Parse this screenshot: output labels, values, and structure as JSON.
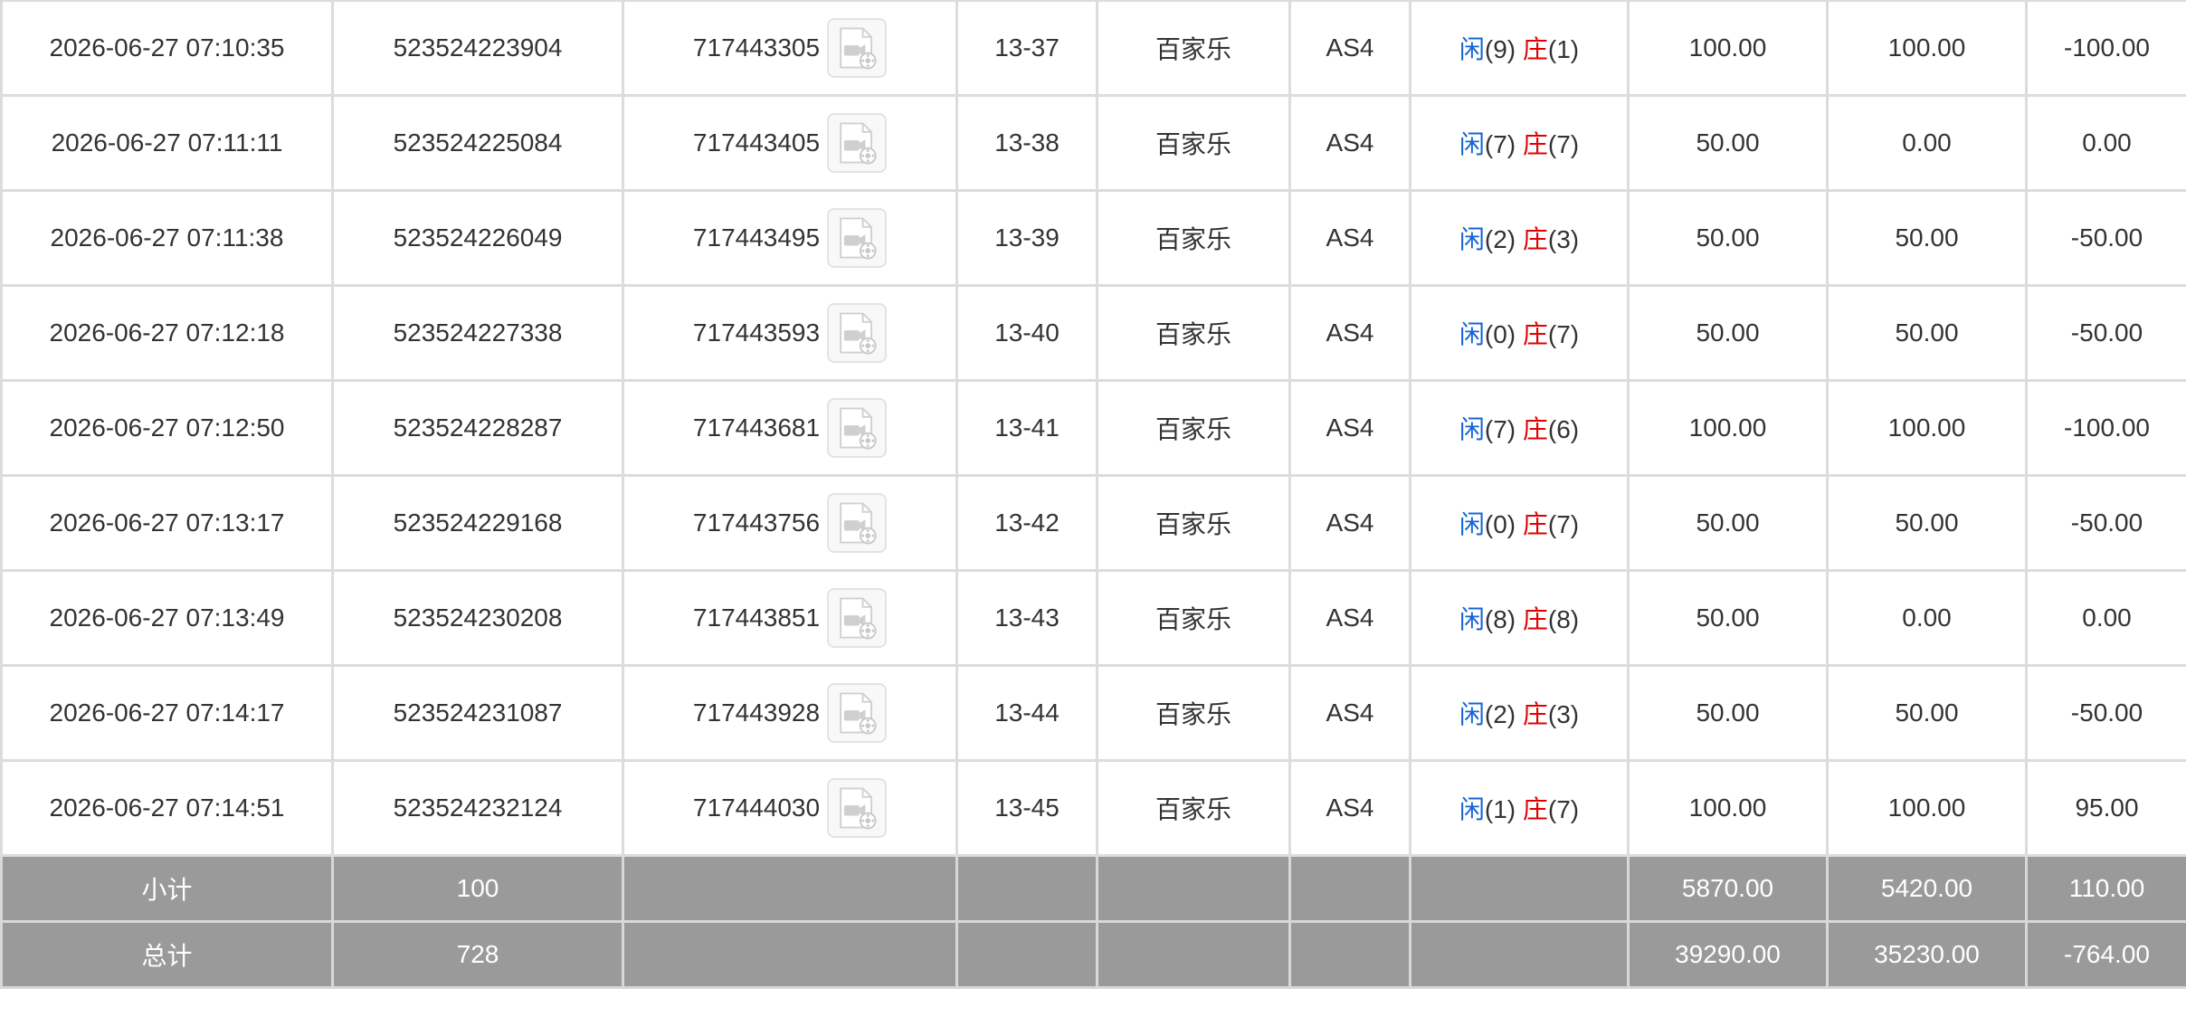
{
  "rows": [
    {
      "time": "2026-06-27 07:10:35",
      "order_id": "523524223904",
      "round_id": "717443305",
      "shoe": "13-37",
      "game": "百家乐",
      "table": "AS4",
      "player_label": "闲",
      "player_score": "(9)",
      "banker_label": "庄",
      "banker_score": "(1)",
      "bet": "100.00",
      "valid_bet": "100.00",
      "payout": "-100.00",
      "payout_negative": true
    },
    {
      "time": "2026-06-27 07:11:11",
      "order_id": "523524225084",
      "round_id": "717443405",
      "shoe": "13-38",
      "game": "百家乐",
      "table": "AS4",
      "player_label": "闲",
      "player_score": "(7)",
      "banker_label": "庄",
      "banker_score": "(7)",
      "bet": "50.00",
      "valid_bet": "0.00",
      "payout": "0.00",
      "payout_negative": false
    },
    {
      "time": "2026-06-27 07:11:38",
      "order_id": "523524226049",
      "round_id": "717443495",
      "shoe": "13-39",
      "game": "百家乐",
      "table": "AS4",
      "player_label": "闲",
      "player_score": "(2)",
      "banker_label": "庄",
      "banker_score": "(3)",
      "bet": "50.00",
      "valid_bet": "50.00",
      "payout": "-50.00",
      "payout_negative": true
    },
    {
      "time": "2026-06-27 07:12:18",
      "order_id": "523524227338",
      "round_id": "717443593",
      "shoe": "13-40",
      "game": "百家乐",
      "table": "AS4",
      "player_label": "闲",
      "player_score": "(0)",
      "banker_label": "庄",
      "banker_score": "(7)",
      "bet": "50.00",
      "valid_bet": "50.00",
      "payout": "-50.00",
      "payout_negative": true
    },
    {
      "time": "2026-06-27 07:12:50",
      "order_id": "523524228287",
      "round_id": "717443681",
      "shoe": "13-41",
      "game": "百家乐",
      "table": "AS4",
      "player_label": "闲",
      "player_score": "(7)",
      "banker_label": "庄",
      "banker_score": "(6)",
      "bet": "100.00",
      "valid_bet": "100.00",
      "payout": "-100.00",
      "payout_negative": true
    },
    {
      "time": "2026-06-27 07:13:17",
      "order_id": "523524229168",
      "round_id": "717443756",
      "shoe": "13-42",
      "game": "百家乐",
      "table": "AS4",
      "player_label": "闲",
      "player_score": "(0)",
      "banker_label": "庄",
      "banker_score": "(7)",
      "bet": "50.00",
      "valid_bet": "50.00",
      "payout": "-50.00",
      "payout_negative": true
    },
    {
      "time": "2026-06-27 07:13:49",
      "order_id": "523524230208",
      "round_id": "717443851",
      "shoe": "13-43",
      "game": "百家乐",
      "table": "AS4",
      "player_label": "闲",
      "player_score": "(8)",
      "banker_label": "庄",
      "banker_score": "(8)",
      "bet": "50.00",
      "valid_bet": "0.00",
      "payout": "0.00",
      "payout_negative": false
    },
    {
      "time": "2026-06-27 07:14:17",
      "order_id": "523524231087",
      "round_id": "717443928",
      "shoe": "13-44",
      "game": "百家乐",
      "table": "AS4",
      "player_label": "闲",
      "player_score": "(2)",
      "banker_label": "庄",
      "banker_score": "(3)",
      "bet": "50.00",
      "valid_bet": "50.00",
      "payout": "-50.00",
      "payout_negative": true
    },
    {
      "time": "2026-06-27 07:14:51",
      "order_id": "523524232124",
      "round_id": "717444030",
      "shoe": "13-45",
      "game": "百家乐",
      "table": "AS4",
      "player_label": "闲",
      "player_score": "(1)",
      "banker_label": "庄",
      "banker_score": "(7)",
      "bet": "100.00",
      "valid_bet": "100.00",
      "payout": "95.00",
      "payout_negative": false
    }
  ],
  "subtotal": {
    "label": "小计",
    "count": "100",
    "bet": "5870.00",
    "valid_bet": "5420.00",
    "payout": "110.00"
  },
  "total": {
    "label": "总计",
    "count": "728",
    "bet": "39290.00",
    "valid_bet": "35230.00",
    "payout": "-764.00"
  },
  "icons": {
    "video": "video-replay-icon"
  },
  "colors": {
    "player": "#1464d2",
    "banker": "#e00000",
    "negative": "#e00000",
    "summary_bg": "#9a9a9a"
  }
}
